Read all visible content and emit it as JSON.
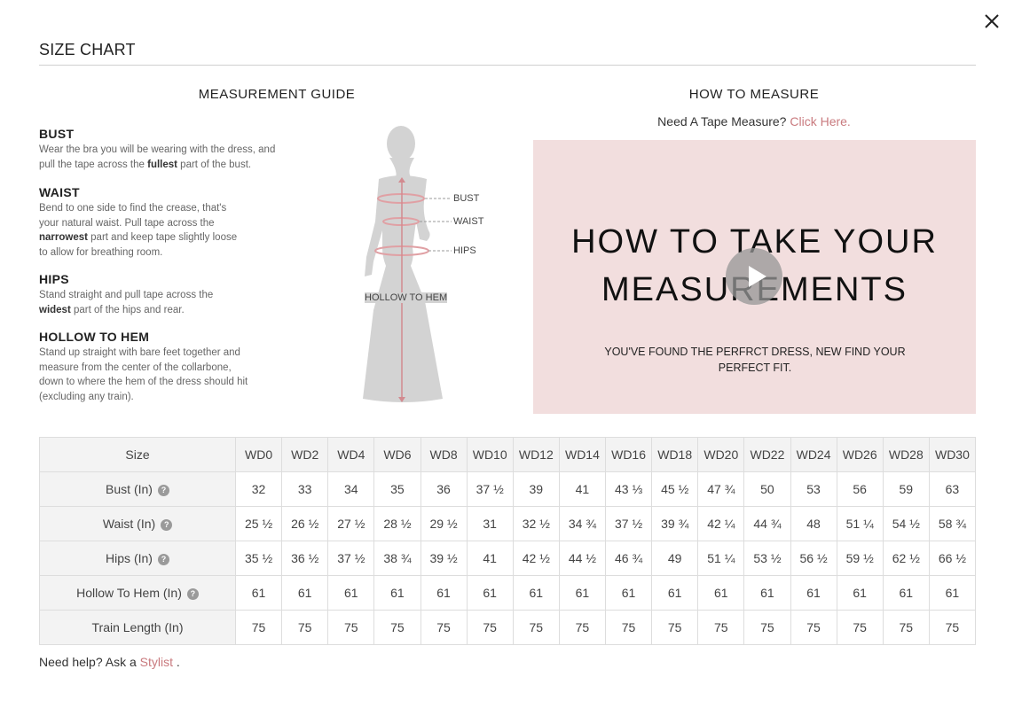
{
  "modal": {
    "title": "SIZE CHART"
  },
  "guide": {
    "title": "MEASUREMENT GUIDE",
    "bust": {
      "heading": "BUST",
      "line1": "Wear the bra you will be wearing with the dress, and",
      "pre": "pull the tape across the ",
      "bold": "fullest",
      "post": " part of the bust."
    },
    "waist": {
      "heading": "WAIST",
      "line1": "Bend to one side to find the crease, that's",
      "line2": "your natural waist. Pull tape across the",
      "bold": "narrowest",
      "post": " part and keep tape slightly loose",
      "line4": "to allow for breathing room."
    },
    "hips": {
      "heading": "HIPS",
      "line1": "Stand straight and pull tape across the",
      "bold": "widest",
      "post": " part of the hips and rear."
    },
    "hollow": {
      "heading": "HOLLOW TO HEM",
      "line1": "Stand up straight with bare feet together and",
      "line2": "measure from the center of the collarbone,",
      "line3": "down to where the hem of the dress should hit",
      "line4": "(excluding any train)."
    },
    "figure_labels": {
      "bust": "BUST",
      "waist": "WAIST",
      "hips": "HIPS",
      "hollow": "HOLLOW TO HEM"
    }
  },
  "how_to": {
    "title": "HOW TO MEASURE",
    "tape_text": "Need A Tape Measure?",
    "tape_link": "Click Here.",
    "video": {
      "line1": "HOW TO TAKE YOUR",
      "line2": "MEASUREMENTS",
      "sub1": "YOU'VE FOUND THE PERFRCT DRESS, NEW FIND YOUR",
      "sub2": "PERFECT FIT."
    }
  },
  "table": {
    "header_label": "Size",
    "sizes": [
      "WD0",
      "WD2",
      "WD4",
      "WD6",
      "WD8",
      "WD10",
      "WD12",
      "WD14",
      "WD16",
      "WD18",
      "WD20",
      "WD22",
      "WD24",
      "WD26",
      "WD28",
      "WD30"
    ],
    "rows": [
      {
        "label": "Bust (In)",
        "help": true,
        "values": [
          "32",
          "33",
          "34",
          "35",
          "36",
          "37 ½",
          "39",
          "41",
          "43 ⅓",
          "45 ½",
          "47 ¾",
          "50",
          "53",
          "56",
          "59",
          "63"
        ]
      },
      {
        "label": "Waist (In)",
        "help": true,
        "values": [
          "25 ½",
          "26 ½",
          "27 ½",
          "28 ½",
          "29 ½",
          "31",
          "32 ½",
          "34 ¾",
          "37 ½",
          "39 ¾",
          "42 ¼",
          "44 ¾",
          "48",
          "51 ¼",
          "54 ½",
          "58 ¾"
        ]
      },
      {
        "label": "Hips (In)",
        "help": true,
        "values": [
          "35 ½",
          "36 ½",
          "37 ½",
          "38 ¾",
          "39 ½",
          "41",
          "42 ½",
          "44 ½",
          "46 ¾",
          "49",
          "51 ¼",
          "53 ½",
          "56 ½",
          "59 ½",
          "62 ½",
          "66 ½"
        ]
      },
      {
        "label": "Hollow To Hem (In)",
        "help": true,
        "values": [
          "61",
          "61",
          "61",
          "61",
          "61",
          "61",
          "61",
          "61",
          "61",
          "61",
          "61",
          "61",
          "61",
          "61",
          "61",
          "61"
        ]
      },
      {
        "label": "Train Length (In)",
        "help": false,
        "values": [
          "75",
          "75",
          "75",
          "75",
          "75",
          "75",
          "75",
          "75",
          "75",
          "75",
          "75",
          "75",
          "75",
          "75",
          "75",
          "75"
        ]
      }
    ]
  },
  "help": {
    "text": "Need help? Ask a",
    "link": "Stylist",
    "end": "."
  },
  "colors": {
    "accent": "#c97a7e",
    "video_bg": "#f2dede",
    "table_header_bg": "#f3f3f3",
    "border": "#dddddd"
  }
}
